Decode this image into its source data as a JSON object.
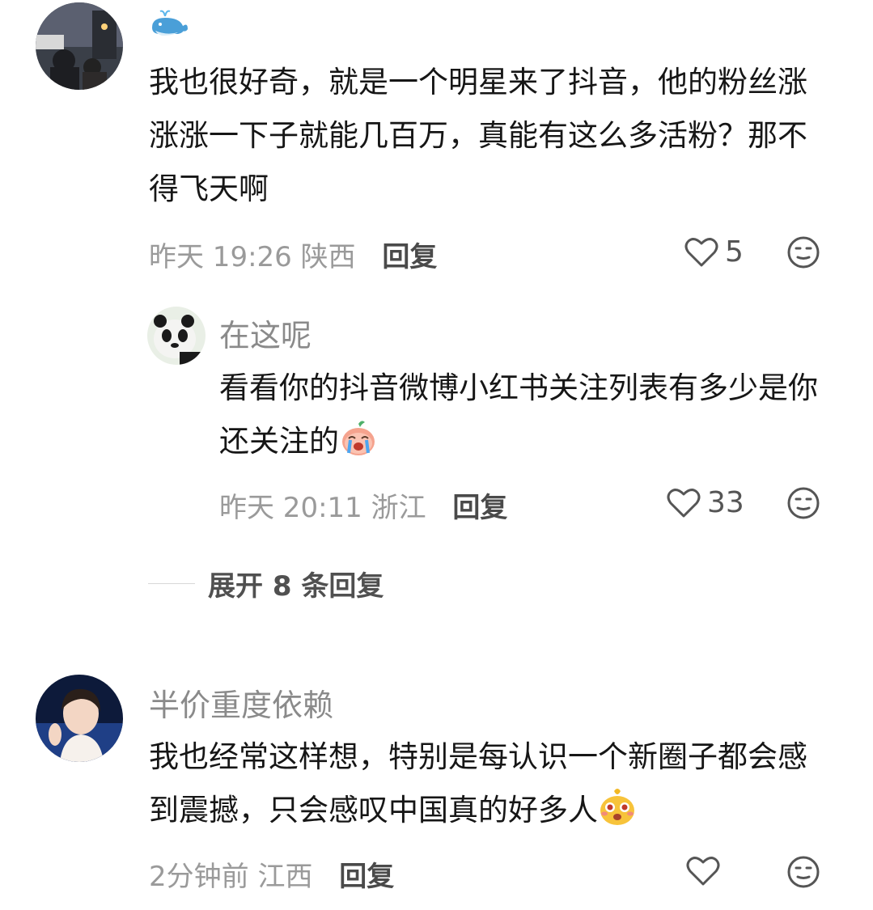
{
  "comments": [
    {
      "name_icon": "whale-icon",
      "text": "我也很好奇，就是一个明星来了抖音，他的粉丝涨涨涨一下子就能几百万，真能有这么多活粉？那不得飞天啊",
      "time": "昨天 19:26",
      "location": "陕西",
      "reply_label": "回复",
      "likes": "5"
    },
    {
      "name": "在这呢",
      "text": "看看你的抖音微博小红书关注列表有多少是你还关注的",
      "emoji": "crying-radish-emoji",
      "time": "昨天 20:11",
      "location": "浙江",
      "reply_label": "回复",
      "likes": "33"
    },
    {
      "name": "半价重度依赖",
      "text": "我也经常这样想，特别是每认识一个新圈子都会感到震撼，只会感叹中国真的好多人",
      "emoji": "amazed-face-emoji",
      "time": "2分钟前",
      "location": "江西",
      "reply_label": "回复",
      "likes": ""
    }
  ],
  "expand_replies": "展开 8 条回复",
  "colors": {
    "text": "#161616",
    "meta": "#9a9a9a",
    "name": "#8a8a8a"
  }
}
